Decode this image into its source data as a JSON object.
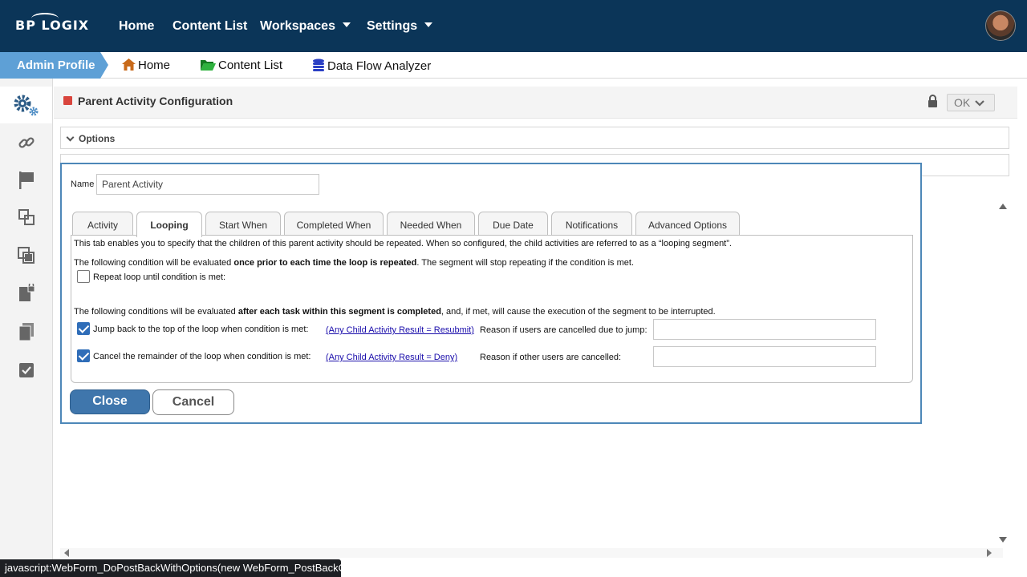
{
  "brand": {
    "logo_text": "BP LOGIX"
  },
  "topnav": {
    "items": [
      {
        "label": "Home"
      },
      {
        "label": "Content List"
      },
      {
        "label": "Workspaces"
      },
      {
        "label": "Settings"
      }
    ]
  },
  "breadcrumb": {
    "profile": "Admin Profile",
    "items": [
      {
        "label": "Home",
        "icon": "home-icon",
        "color": "#c86a1a"
      },
      {
        "label": "Content List",
        "icon": "folder-icon",
        "color": "#1f9a2e"
      },
      {
        "label": "Data Flow Analyzer",
        "icon": "database-icon",
        "color": "#2a3fc4"
      }
    ]
  },
  "sidebar": {
    "items": [
      {
        "icon": "gears-icon"
      },
      {
        "icon": "link-icon"
      },
      {
        "icon": "flag-icon"
      },
      {
        "icon": "layers-icon"
      },
      {
        "icon": "copy-icon"
      },
      {
        "icon": "locked-file-icon"
      },
      {
        "icon": "documents-icon"
      },
      {
        "icon": "checklist-icon"
      }
    ]
  },
  "panel": {
    "title": "Parent Activity Configuration",
    "ok_label": "OK",
    "options_label": "Options"
  },
  "dialog": {
    "name_label": "Name",
    "name_value": "Parent Activity",
    "tabs": [
      {
        "label": "Activity"
      },
      {
        "label": "Looping",
        "active": true
      },
      {
        "label": "Start When"
      },
      {
        "label": "Completed When"
      },
      {
        "label": "Needed When"
      },
      {
        "label": "Due Date"
      },
      {
        "label": "Notifications"
      },
      {
        "label": "Advanced Options"
      }
    ],
    "looping": {
      "intro": "This tab enables you to specify that the children of this parent activity should be repeated. When so configured, the child activities are referred to as a “looping segment”.",
      "cond1_pre": "The following condition will be evaluated ",
      "cond1_bold": "once prior to each time the loop is repeated",
      "cond1_post": ". The segment will stop repeating if the condition is met.",
      "repeat_label": "Repeat loop until condition is met:",
      "repeat_checked": false,
      "cond2_pre": "The following conditions will be evaluated ",
      "cond2_bold": "after each task within this segment is completed",
      "cond2_post": ", and, if met, will cause the execution of the segment to be interrupted.",
      "jump_label": "Jump back to the top of the loop when condition is met:",
      "jump_checked": true,
      "jump_condition": "(Any Child Activity Result = Resubmit)",
      "jump_reason_label": "Reason if users are cancelled due to jump:",
      "jump_reason_value": "",
      "cancel_label": "Cancel the remainder of the loop when condition is met:",
      "cancel_checked": true,
      "cancel_condition": "(Any Child Activity Result = Deny)",
      "cancel_reason_label": "Reason if other users are cancelled:",
      "cancel_reason_value": ""
    },
    "close_label": "Close",
    "cancel_button_label": "Cancel"
  },
  "status_bar": "javascript:WebForm_DoPostBackWithOptions(new WebForm_PostBackOptio..."
}
